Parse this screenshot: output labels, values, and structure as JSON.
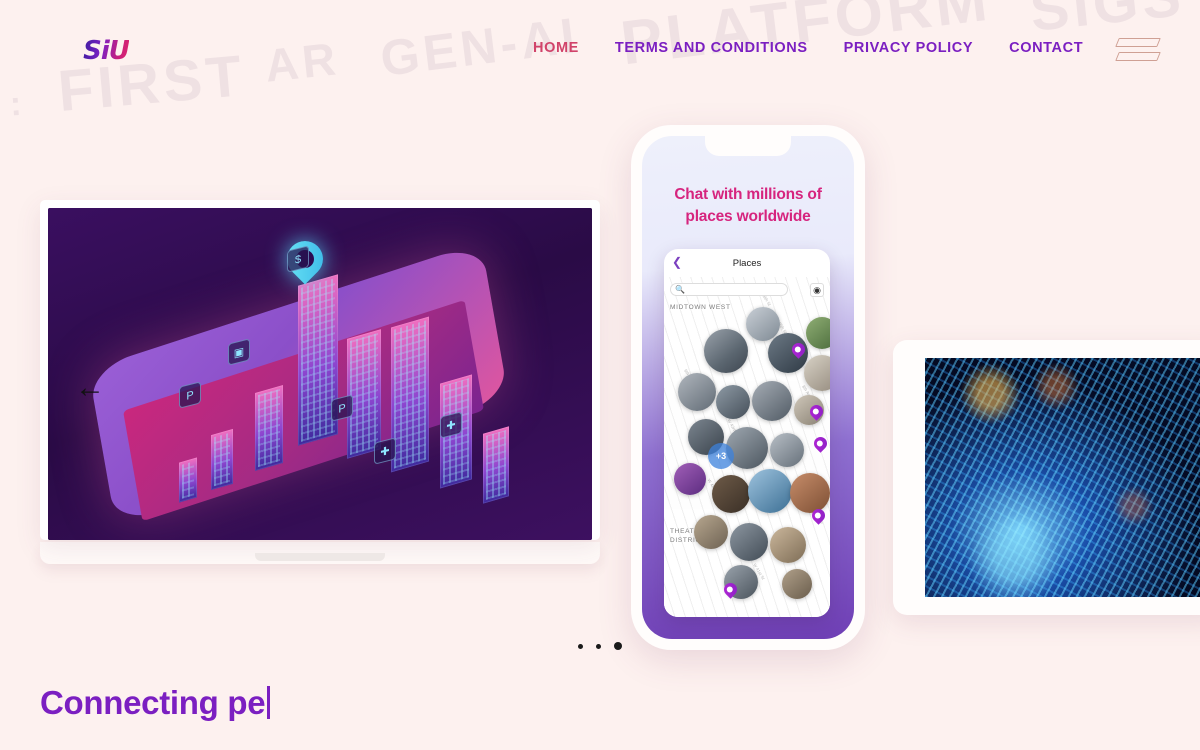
{
  "background_words": {
    "colon": ":",
    "first": "FIRST",
    "ar": "AR",
    "gen_ai": "GEN-AI",
    "platform": "PLATFORM",
    "sigs": "SIGS"
  },
  "header": {
    "logo_text": "SiU",
    "nav": [
      {
        "label": "HOME",
        "active": true
      },
      {
        "label": "TERMS AND CONDITIONS",
        "active": false
      },
      {
        "label": "PRIVACY POLICY",
        "active": false
      },
      {
        "label": "CONTACT",
        "active": false
      }
    ],
    "menu_icon": "hamburger-icon"
  },
  "carousel": {
    "prev_arrow": "←",
    "dots": [
      {
        "active": false
      },
      {
        "active": false
      },
      {
        "active": true
      }
    ],
    "laptop": {
      "alt": "isometric smart city augmented reality illustration"
    },
    "phone": {
      "headline_line1": "Chat with millions of",
      "headline_line2": "places worldwide",
      "app": {
        "back_icon": "chevron-left-icon",
        "title": "Places",
        "search_placeholder": "",
        "search_icon": "search-icon",
        "locate_icon": "crosshair-icon",
        "map_labels": [
          "MIDTOWN WEST",
          "THEATER DISTRICT"
        ],
        "streets": [
          "W 48th St",
          "W 45th St",
          "W 44th St",
          "W 43rd St",
          "W 42nd St",
          "W 41st St",
          "8th Ave",
          "9th Ave",
          "7th Ave"
        ],
        "cluster_badge": "+3"
      }
    },
    "tablet": {
      "alt": "blue abstract digital circuit data visualization"
    }
  },
  "hero": {
    "typed_text": "Connecting pe"
  },
  "colors": {
    "page_background": "#fdf1ef",
    "nav_purple": "#7b1fc1",
    "nav_active_rose": "#d1436a",
    "phone_headline_pink": "#d6247e",
    "headline_purple": "#7b1fc1",
    "bg_word": "#eddfe1",
    "hamburger_outline": "#cfa094"
  }
}
